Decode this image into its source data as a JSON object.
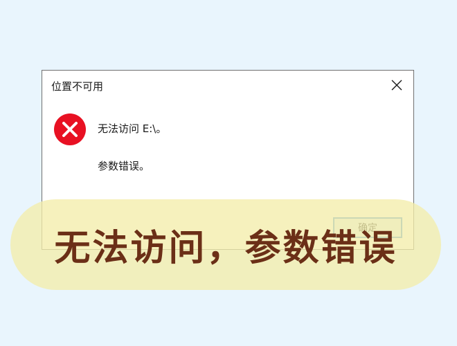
{
  "dialog": {
    "title": "位置不可用",
    "close_icon": "close-icon",
    "error_icon": "error-icon",
    "message_main": "无法访问 E:\\。",
    "message_sub": "参数错误。",
    "ok_label": "确定"
  },
  "overlay": {
    "caption": "无法访问，参数错误"
  },
  "colors": {
    "page_background": "#e9f5fd",
    "error_red": "#e81123",
    "overlay_fill": "#f3edaa",
    "overlay_text": "#6b2f17",
    "focus_blue": "#3b8fd8"
  }
}
